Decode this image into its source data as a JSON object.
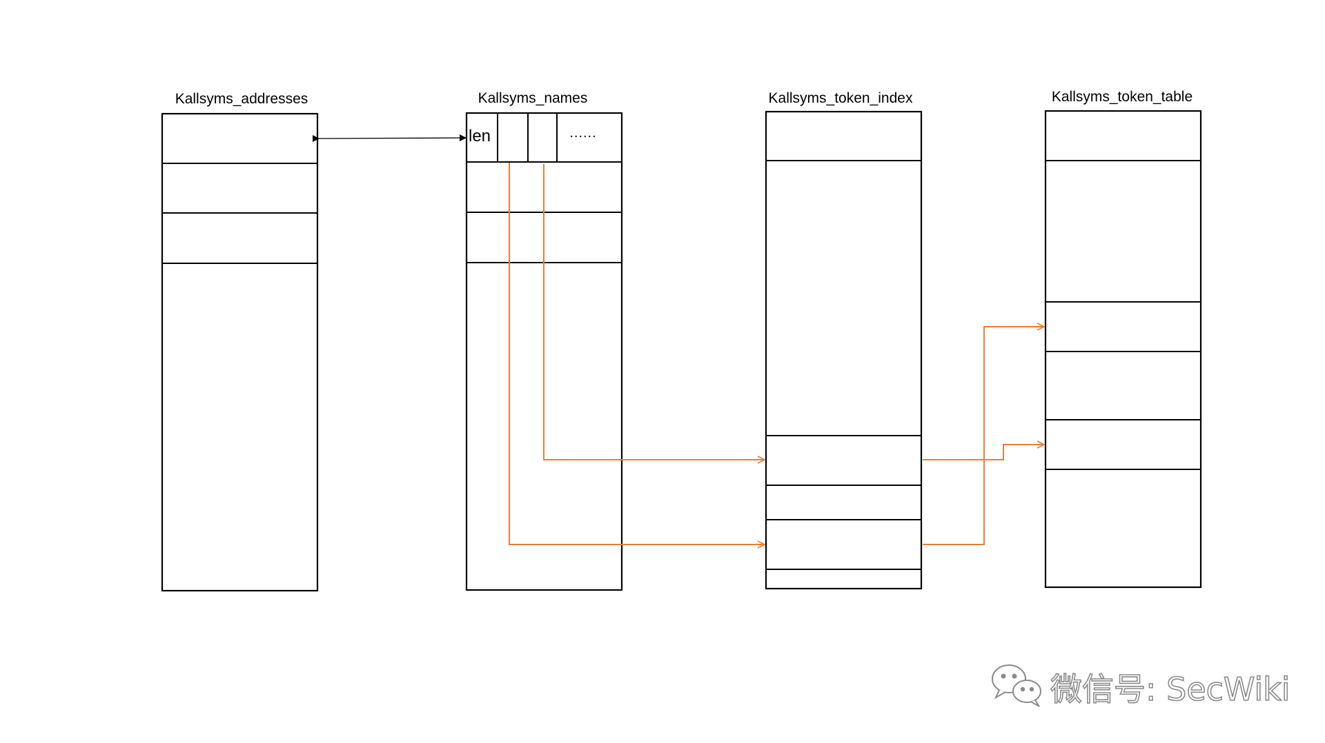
{
  "titles": {
    "addresses": "Kallsyms_addresses",
    "names": "Kallsyms_names",
    "token_index": "Kallsyms_token_index",
    "token_table": "Kallsyms_token_table"
  },
  "names_cell": {
    "len": "len",
    "ellipsis": "......"
  },
  "watermark": {
    "text": "微信号: SecWiki"
  },
  "colors": {
    "stroke": "#000000",
    "arrow_orange": "#ED7D31",
    "background": "#FFFFFF",
    "watermark_outline": "#8A8A8A"
  },
  "icons": {
    "watermark_logo": "wechat-icon"
  }
}
